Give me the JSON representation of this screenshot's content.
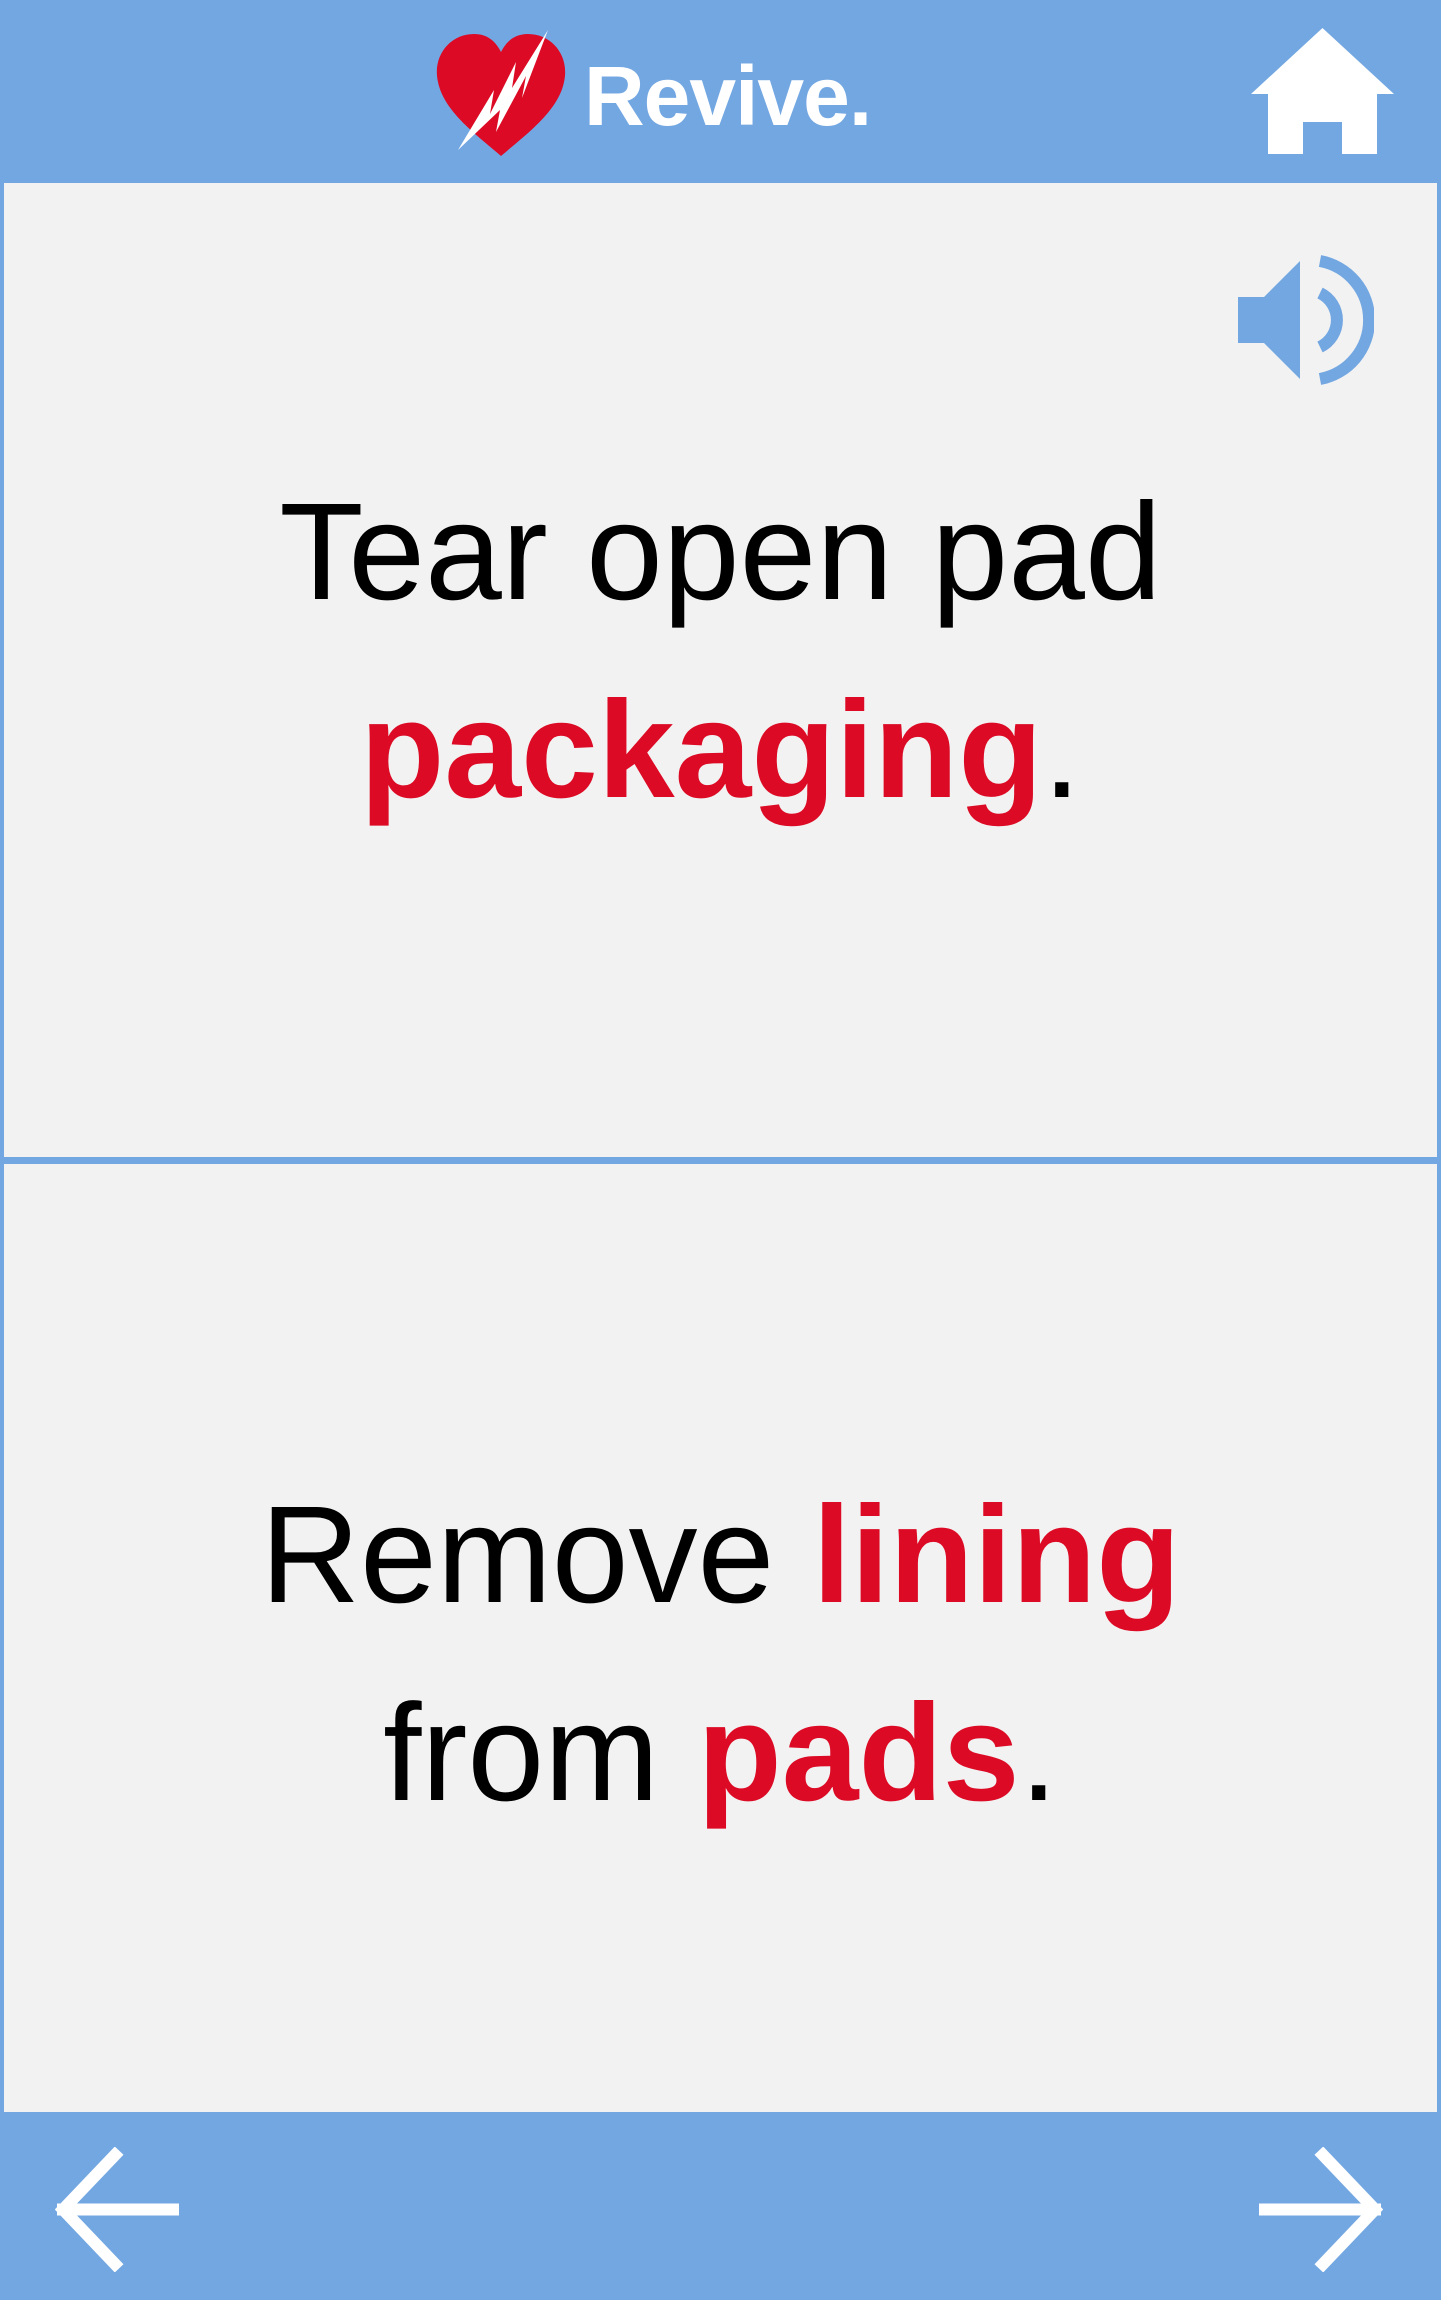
{
  "app": {
    "name": "Revive.",
    "logo_icon": "heart-lightning-icon"
  },
  "header": {
    "home_icon": "home-icon"
  },
  "colors": {
    "bar_blue": "#73a7e2",
    "panel_bg": "#f2f2f2",
    "highlight_red": "#dc0a24",
    "text_black": "#000000"
  },
  "steps": [
    {
      "audio_icon": "speaker-icon",
      "line1": "Tear open pad",
      "line2_highlight": "packaging",
      "line2_tail": "."
    },
    {
      "line1_lead": "Remove ",
      "line1_highlight": "lining",
      "line2_lead": "from ",
      "line2_highlight": "pads",
      "line2_tail": "."
    }
  ],
  "footer": {
    "back_icon": "arrow-left-icon",
    "next_icon": "arrow-right-icon"
  }
}
